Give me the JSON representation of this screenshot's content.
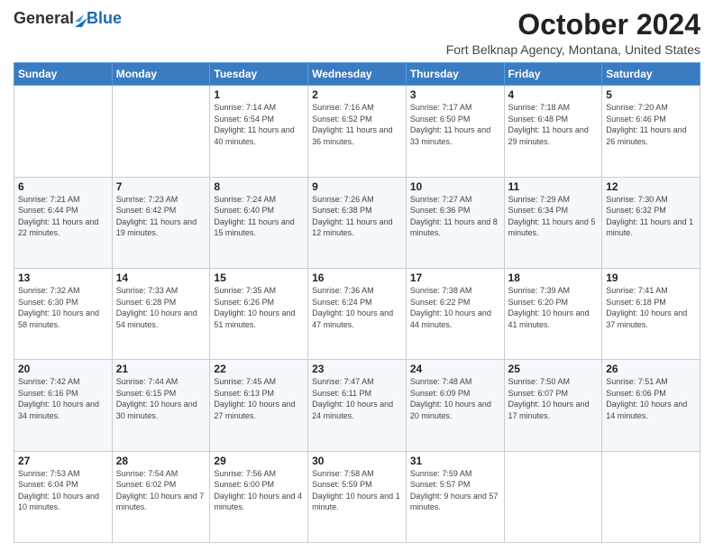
{
  "header": {
    "logo": {
      "general": "General",
      "blue": "Blue"
    },
    "month": "October 2024",
    "location": "Fort Belknap Agency, Montana, United States"
  },
  "weekdays": [
    "Sunday",
    "Monday",
    "Tuesday",
    "Wednesday",
    "Thursday",
    "Friday",
    "Saturday"
  ],
  "weeks": [
    [
      {
        "day": null
      },
      {
        "day": null
      },
      {
        "day": "1",
        "sunrise": "Sunrise: 7:14 AM",
        "sunset": "Sunset: 6:54 PM",
        "daylight": "Daylight: 11 hours and 40 minutes."
      },
      {
        "day": "2",
        "sunrise": "Sunrise: 7:16 AM",
        "sunset": "Sunset: 6:52 PM",
        "daylight": "Daylight: 11 hours and 36 minutes."
      },
      {
        "day": "3",
        "sunrise": "Sunrise: 7:17 AM",
        "sunset": "Sunset: 6:50 PM",
        "daylight": "Daylight: 11 hours and 33 minutes."
      },
      {
        "day": "4",
        "sunrise": "Sunrise: 7:18 AM",
        "sunset": "Sunset: 6:48 PM",
        "daylight": "Daylight: 11 hours and 29 minutes."
      },
      {
        "day": "5",
        "sunrise": "Sunrise: 7:20 AM",
        "sunset": "Sunset: 6:46 PM",
        "daylight": "Daylight: 11 hours and 26 minutes."
      }
    ],
    [
      {
        "day": "6",
        "sunrise": "Sunrise: 7:21 AM",
        "sunset": "Sunset: 6:44 PM",
        "daylight": "Daylight: 11 hours and 22 minutes."
      },
      {
        "day": "7",
        "sunrise": "Sunrise: 7:23 AM",
        "sunset": "Sunset: 6:42 PM",
        "daylight": "Daylight: 11 hours and 19 minutes."
      },
      {
        "day": "8",
        "sunrise": "Sunrise: 7:24 AM",
        "sunset": "Sunset: 6:40 PM",
        "daylight": "Daylight: 11 hours and 15 minutes."
      },
      {
        "day": "9",
        "sunrise": "Sunrise: 7:26 AM",
        "sunset": "Sunset: 6:38 PM",
        "daylight": "Daylight: 11 hours and 12 minutes."
      },
      {
        "day": "10",
        "sunrise": "Sunrise: 7:27 AM",
        "sunset": "Sunset: 6:36 PM",
        "daylight": "Daylight: 11 hours and 8 minutes."
      },
      {
        "day": "11",
        "sunrise": "Sunrise: 7:29 AM",
        "sunset": "Sunset: 6:34 PM",
        "daylight": "Daylight: 11 hours and 5 minutes."
      },
      {
        "day": "12",
        "sunrise": "Sunrise: 7:30 AM",
        "sunset": "Sunset: 6:32 PM",
        "daylight": "Daylight: 11 hours and 1 minute."
      }
    ],
    [
      {
        "day": "13",
        "sunrise": "Sunrise: 7:32 AM",
        "sunset": "Sunset: 6:30 PM",
        "daylight": "Daylight: 10 hours and 58 minutes."
      },
      {
        "day": "14",
        "sunrise": "Sunrise: 7:33 AM",
        "sunset": "Sunset: 6:28 PM",
        "daylight": "Daylight: 10 hours and 54 minutes."
      },
      {
        "day": "15",
        "sunrise": "Sunrise: 7:35 AM",
        "sunset": "Sunset: 6:26 PM",
        "daylight": "Daylight: 10 hours and 51 minutes."
      },
      {
        "day": "16",
        "sunrise": "Sunrise: 7:36 AM",
        "sunset": "Sunset: 6:24 PM",
        "daylight": "Daylight: 10 hours and 47 minutes."
      },
      {
        "day": "17",
        "sunrise": "Sunrise: 7:38 AM",
        "sunset": "Sunset: 6:22 PM",
        "daylight": "Daylight: 10 hours and 44 minutes."
      },
      {
        "day": "18",
        "sunrise": "Sunrise: 7:39 AM",
        "sunset": "Sunset: 6:20 PM",
        "daylight": "Daylight: 10 hours and 41 minutes."
      },
      {
        "day": "19",
        "sunrise": "Sunrise: 7:41 AM",
        "sunset": "Sunset: 6:18 PM",
        "daylight": "Daylight: 10 hours and 37 minutes."
      }
    ],
    [
      {
        "day": "20",
        "sunrise": "Sunrise: 7:42 AM",
        "sunset": "Sunset: 6:16 PM",
        "daylight": "Daylight: 10 hours and 34 minutes."
      },
      {
        "day": "21",
        "sunrise": "Sunrise: 7:44 AM",
        "sunset": "Sunset: 6:15 PM",
        "daylight": "Daylight: 10 hours and 30 minutes."
      },
      {
        "day": "22",
        "sunrise": "Sunrise: 7:45 AM",
        "sunset": "Sunset: 6:13 PM",
        "daylight": "Daylight: 10 hours and 27 minutes."
      },
      {
        "day": "23",
        "sunrise": "Sunrise: 7:47 AM",
        "sunset": "Sunset: 6:11 PM",
        "daylight": "Daylight: 10 hours and 24 minutes."
      },
      {
        "day": "24",
        "sunrise": "Sunrise: 7:48 AM",
        "sunset": "Sunset: 6:09 PM",
        "daylight": "Daylight: 10 hours and 20 minutes."
      },
      {
        "day": "25",
        "sunrise": "Sunrise: 7:50 AM",
        "sunset": "Sunset: 6:07 PM",
        "daylight": "Daylight: 10 hours and 17 minutes."
      },
      {
        "day": "26",
        "sunrise": "Sunrise: 7:51 AM",
        "sunset": "Sunset: 6:06 PM",
        "daylight": "Daylight: 10 hours and 14 minutes."
      }
    ],
    [
      {
        "day": "27",
        "sunrise": "Sunrise: 7:53 AM",
        "sunset": "Sunset: 6:04 PM",
        "daylight": "Daylight: 10 hours and 10 minutes."
      },
      {
        "day": "28",
        "sunrise": "Sunrise: 7:54 AM",
        "sunset": "Sunset: 6:02 PM",
        "daylight": "Daylight: 10 hours and 7 minutes."
      },
      {
        "day": "29",
        "sunrise": "Sunrise: 7:56 AM",
        "sunset": "Sunset: 6:00 PM",
        "daylight": "Daylight: 10 hours and 4 minutes."
      },
      {
        "day": "30",
        "sunrise": "Sunrise: 7:58 AM",
        "sunset": "Sunset: 5:59 PM",
        "daylight": "Daylight: 10 hours and 1 minute."
      },
      {
        "day": "31",
        "sunrise": "Sunrise: 7:59 AM",
        "sunset": "Sunset: 5:57 PM",
        "daylight": "Daylight: 9 hours and 57 minutes."
      },
      {
        "day": null
      },
      {
        "day": null
      }
    ]
  ]
}
